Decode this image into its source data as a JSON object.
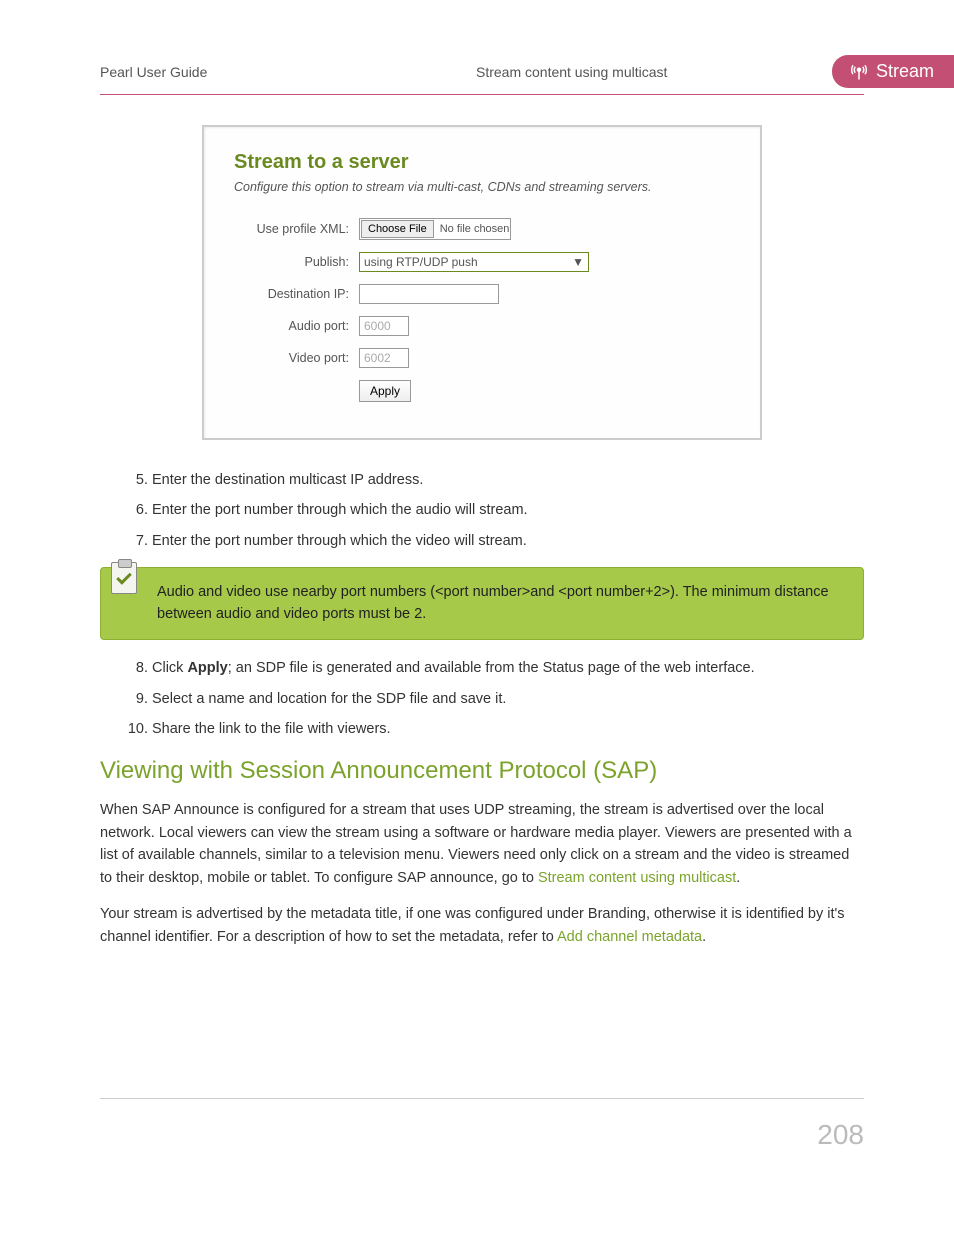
{
  "header": {
    "left": "Pearl User Guide",
    "center": "Stream content using multicast",
    "tab": "Stream"
  },
  "inset": {
    "title": "Stream to a server",
    "subtitle": "Configure this option to stream via multi-cast, CDNs and streaming servers.",
    "rows": {
      "profile_label": "Use profile XML:",
      "choose_file_btn": "Choose File",
      "no_file": "No file chosen",
      "publish_label": "Publish:",
      "publish_value": "using RTP/UDP push",
      "dest_label": "Destination IP:",
      "dest_value": "",
      "audio_label": "Audio port:",
      "audio_value": "6000",
      "video_label": "Video port:",
      "video_value": "6002",
      "apply": "Apply"
    }
  },
  "steps_a": [
    {
      "n": "5",
      "text": "Enter the destination multicast IP address."
    },
    {
      "n": "6",
      "text": "Enter the port number through which the audio will stream."
    },
    {
      "n": "7",
      "text": "Enter the port number through which the video will stream."
    }
  ],
  "note": "Audio and video use nearby port numbers (<port number>and <port number+2>). The minimum distance between audio and video ports must be 2.",
  "steps_b": [
    {
      "n": "8",
      "pre": "Click ",
      "bold": "Apply",
      "post": "; an SDP file is generated and available from the Status page of the web interface."
    },
    {
      "n": "9",
      "text": "Select a name and location for the SDP file and save it."
    },
    {
      "n": "10",
      "text": "Share the link to the file with viewers."
    }
  ],
  "section_title": "Viewing with Session Announcement Protocol (SAP)",
  "para1": {
    "t1": "When SAP Announce is configured for a stream that uses UDP streaming, the stream is advertised over the local network. Local viewers can view the stream using a software or hardware media player. Viewers are presented with a list of available channels, similar to a television menu. Viewers need only click on a stream and the video is streamed to their desktop, mobile or tablet. To configure SAP announce, go to ",
    "link": "Stream content using multicast",
    "t2": "."
  },
  "para2": {
    "t1": "Your stream is advertised by the metadata title, if one was configured under Branding, otherwise it is identified by it's channel identifier. For a description of how to set the metadata, refer to ",
    "link": "Add channel metadata",
    "t2": "."
  },
  "page_number": "208"
}
